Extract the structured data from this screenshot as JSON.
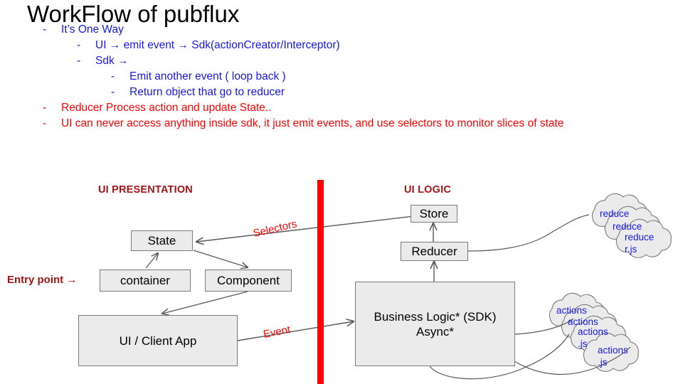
{
  "slide": {
    "title": "WorkFlow of pubflux"
  },
  "bullets": [
    {
      "level": 1,
      "color": "blue",
      "text": "It’s One Way"
    },
    {
      "level": 2,
      "color": "blue",
      "text": "UI → emit event → Sdk(actionCreator/Interceptor)"
    },
    {
      "level": 2,
      "color": "blue",
      "text": "Sdk →"
    },
    {
      "level": 3,
      "color": "blue",
      "text": "Emit another event ( loop back )"
    },
    {
      "level": 3,
      "color": "blue",
      "text": "Return object that go to reducer"
    },
    {
      "level": 1,
      "color": "red",
      "text": "Reducer Process action and update State.."
    },
    {
      "level": 1,
      "color": "red",
      "wrap": true,
      "text": "UI can never access anything inside sdk, it just emit events, and use selectors to monitor slices of state"
    }
  ],
  "bullet_marker": "-",
  "diagram": {
    "section_labels": {
      "left": "UI PRESENTATION",
      "right": "UI LOGIC"
    },
    "entry_label": "Entry point →",
    "nodes": {
      "state": "State",
      "container": "container",
      "component": "Component",
      "ui_client_app": "UI / Client App",
      "store": "Store",
      "reducer": "Reducer",
      "business_logic": "Business Logic* (SDK)\nAsync*"
    },
    "edge_labels": {
      "selectors": "Selectors",
      "event": "Event"
    },
    "clouds": {
      "reducer_group": [
        {
          "line1": "reduce",
          "line2": "r.js"
        },
        {
          "line1": "reduce",
          "line2": "r.js"
        },
        {
          "line1": "reduce",
          "line2": "r.js"
        }
      ],
      "actions_group": [
        {
          "line1": "actions",
          "line2": ".js"
        },
        {
          "line1": "actions",
          "line2": ".js"
        },
        {
          "line1": "actions",
          "line2": ".js"
        },
        {
          "line1": "actions",
          "line2": ".js"
        }
      ]
    },
    "colors": {
      "divider": "#fc0000",
      "section_label": "#a31515",
      "edge_label": "#fc0303",
      "box_fill": "#ebebeb",
      "box_stroke": "#7a7a7a",
      "cloud_text": "#1818e6",
      "arrow": "#595959"
    }
  }
}
